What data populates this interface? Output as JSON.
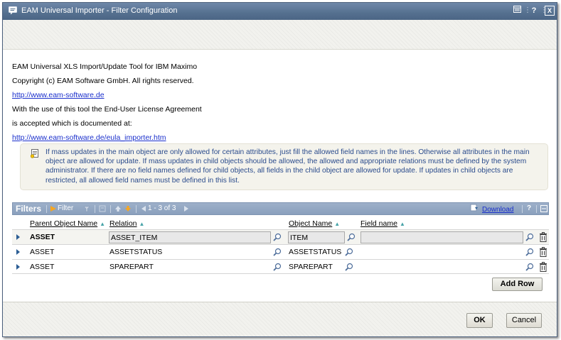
{
  "window": {
    "title": "EAM Universal Importer - Filter Configuration",
    "controls": [
      "restore-icon",
      "help-icon",
      "close-icon"
    ],
    "help_label": "?",
    "close_label": "X"
  },
  "info": {
    "line1": "EAM Universal XLS Import/Update Tool for IBM Maximo",
    "line2": "Copyright (c) EAM Software GmbH. All rights reserved.",
    "link1": "http://www.eam-software.de",
    "line3": "With the use of this tool the End-User License Agreement",
    "line4": "is accepted which is documented at:",
    "link2": "http://www.eam-software.de/eula_importer.htm"
  },
  "note": {
    "text": "If mass updates in the main object are only allowed for certain attributes, just fill the allowed field names in the lines. Otherwise all attributes in the main object are allowed for update. If mass updates in child objects should be allowed, the allowed and appropriate relations must be defined by the system administrator. If there are no field names defined for child objects, all fields in the child object are allowed for update. If updates in child objects are restricted, all allowed field names must be defined in this list."
  },
  "filters": {
    "title": "Filters",
    "filter_label": "Filter",
    "pagination": "1 - 3 of 3",
    "download_label": "Download",
    "help_label": "?",
    "columns": {
      "parent_object": "Parent Object Name",
      "relation": "Relation",
      "object_name": "Object Name",
      "field_name": "Field name"
    },
    "rows": [
      {
        "parent": "ASSET",
        "relation": "ASSET_ITEM",
        "object": "ITEM",
        "field": "",
        "selected": true
      },
      {
        "parent": "ASSET",
        "relation": "ASSETSTATUS",
        "object": "ASSETSTATUS",
        "field": "",
        "selected": false
      },
      {
        "parent": "ASSET",
        "relation": "SPAREPART",
        "object": "SPAREPART",
        "field": "",
        "selected": false
      }
    ],
    "add_row_label": "Add Row"
  },
  "buttons": {
    "ok": "OK",
    "cancel": "Cancel"
  },
  "colors": {
    "titlebar": "#55708f",
    "filterbar": "#8aa0bd",
    "link": "#1a2fcc",
    "note_text": "#2a4b8c"
  }
}
